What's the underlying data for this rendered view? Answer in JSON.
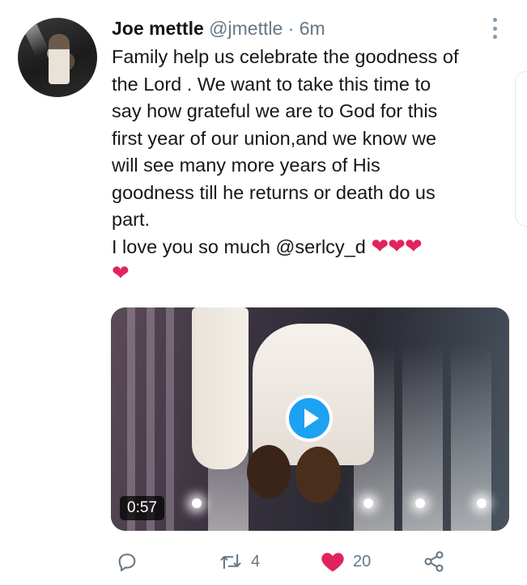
{
  "tweet": {
    "display_name": "Joe mettle",
    "handle": "@jmettle",
    "separator": "·",
    "time": "6m",
    "text_lines": [
      "Family help us celebrate the goodness of",
      "the Lord . We want to take this time to",
      "say how grateful we are to God for this",
      "first year of our union,and we know we",
      "will see many more years of His",
      "goodness till he returns or death do us",
      "part."
    ],
    "love_line": "I love you so much @serlcy_d",
    "hearts_inline": "❤❤❤",
    "heart_last": "❤",
    "video": {
      "duration": "0:57"
    }
  },
  "actions": {
    "reply_count": "",
    "retweet_count": "4",
    "like_count": "20"
  },
  "colors": {
    "accent": "#1da1f2",
    "like": "#e0245e",
    "muted": "#657786"
  },
  "icons": [
    "avatar",
    "more-vertical-icon",
    "play-icon",
    "reply-icon",
    "retweet-icon",
    "like-icon",
    "share-icon"
  ]
}
